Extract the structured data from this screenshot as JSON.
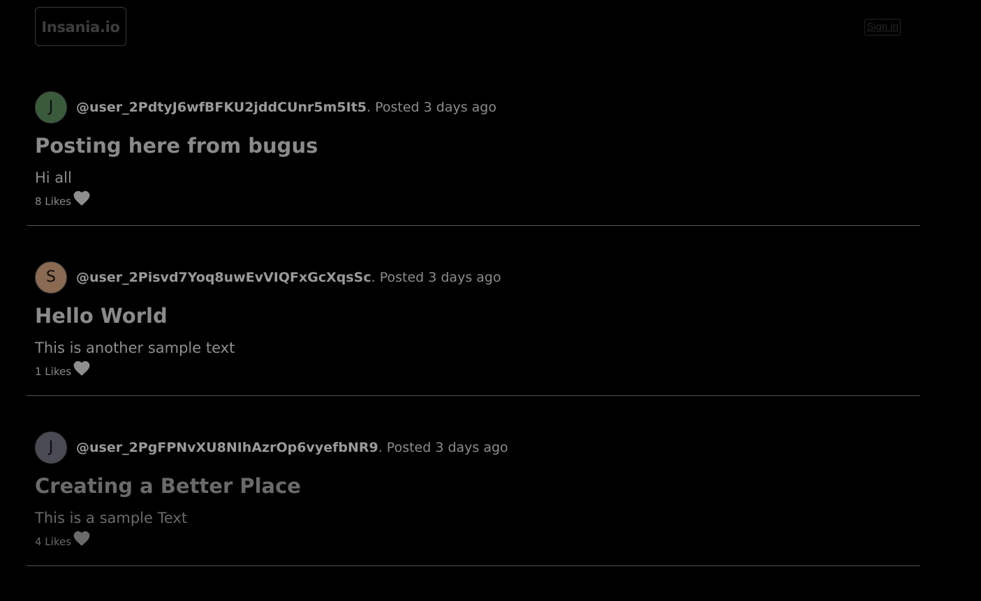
{
  "header": {
    "brand": "Insania.io",
    "sign_in_label": "Sign in"
  },
  "posts": [
    {
      "avatar_initial": "J",
      "avatar_color": "#3a5a3c",
      "author": "@user_2PdtyJ6wfBFKU2jddCUnr5m5It5",
      "posted": ". Posted 3 days ago",
      "title": "Posting here from bugus",
      "body": "Hi all",
      "likes": "8 Likes",
      "like_icon": "heart-icon"
    },
    {
      "avatar_initial": "S",
      "avatar_color": "#8a6a52",
      "author": "@user_2Pisvd7Yoq8uwEvVIQFxGcXqsSc",
      "posted": ". Posted 3 days ago",
      "title": "Hello World",
      "body": "This is another sample text",
      "likes": "1 Likes",
      "like_icon": "heart-icon"
    },
    {
      "avatar_initial": "J",
      "avatar_color": "#4a4a54",
      "author": "@user_2PgFPNvXU8NIhAzrOp6vyefbNR9",
      "posted": ". Posted 3 days ago",
      "title": "Creating a Better Place",
      "body": "This is a sample Text",
      "likes": "4 Likes",
      "like_icon": "heart-icon"
    }
  ]
}
